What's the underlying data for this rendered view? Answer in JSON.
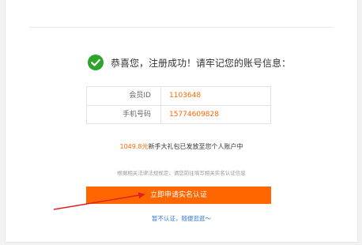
{
  "success": {
    "icon": "check-circle-icon",
    "icon_color": "#2aa52a",
    "message": "恭喜您，注册成功！请牢记您的账号信息："
  },
  "account_info": {
    "rows": [
      {
        "label": "会员ID",
        "value": "1103648"
      },
      {
        "label": "手机号码",
        "value": "15774609828"
      }
    ]
  },
  "gift": {
    "amount": "1049.8元",
    "text": "新手大礼包已发放至您个人账户中"
  },
  "notice": "根据相关法律法规规定，请您前往填写相关实名认证信息",
  "actions": {
    "apply_label": "立即申请实名认证",
    "skip_label": "暂不认证，随便逛逛～"
  },
  "colors": {
    "accent": "#ff6600",
    "link": "#3a7bd5",
    "annotation_arrow": "#e02020"
  },
  "annotation": {
    "icon": "red-arrow-annotation"
  }
}
